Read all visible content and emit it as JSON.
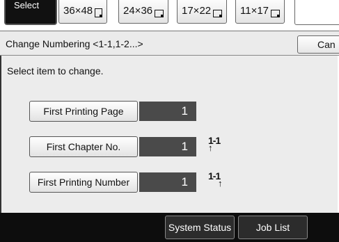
{
  "topbar": {
    "select_label": "Select",
    "paper_sizes": [
      "36×48",
      "24×36",
      "17×22",
      "11×17"
    ]
  },
  "header": {
    "title": "Change Numbering <1-1,1-2...>",
    "cancel_label": "Can"
  },
  "main": {
    "instruction": "Select item to change.",
    "rows": [
      {
        "label": "First Printing Page",
        "value": "1",
        "icon_text": ""
      },
      {
        "label": "First Chapter No.",
        "value": "1",
        "icon_text": "1-1"
      },
      {
        "label": "First Printing Number",
        "value": "1",
        "icon_text": "1-1"
      }
    ]
  },
  "bottombar": {
    "system_status_label": "System Status",
    "job_list_label": "Job List"
  },
  "icons": {
    "paper_size_icon": "page-corner-icon",
    "numbering_icon": "arrow-up-icon"
  },
  "colors": {
    "value_box": "#4a4a4a",
    "bottom_bar": "#0d0d0d",
    "panel": "#ececec"
  }
}
